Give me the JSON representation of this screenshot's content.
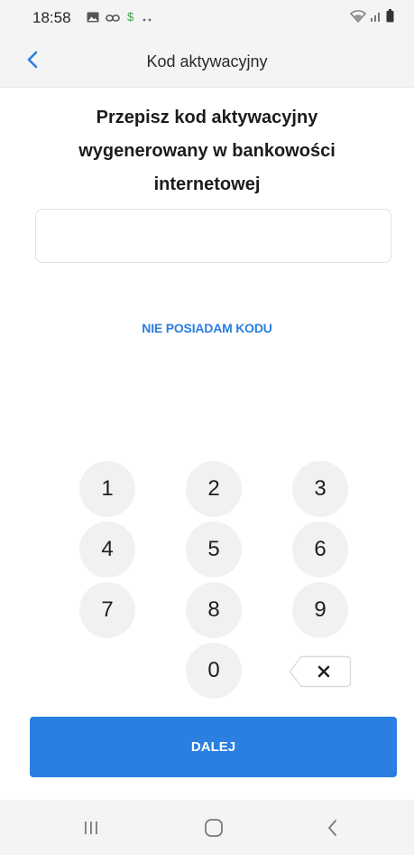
{
  "status_bar": {
    "time": "18:58",
    "left_icons": [
      "gallery-icon",
      "link-icon",
      "dollar-icon",
      "more-dots-icon"
    ],
    "right_icons": [
      "wifi-icon",
      "signal-icon",
      "battery-icon"
    ]
  },
  "header": {
    "title": "Kod aktywacyjny",
    "back_icon": "chevron-left-icon"
  },
  "instruction": "Przepisz kod aktywacyjny wygenerowany w bankowości internetowej",
  "code_input": {
    "value": "",
    "placeholder": ""
  },
  "no_code_link": "NIE POSIADAM KODU",
  "keypad": {
    "keys": [
      "1",
      "2",
      "3",
      "4",
      "5",
      "6",
      "7",
      "8",
      "9",
      "0"
    ],
    "backspace_icon": "backspace-icon"
  },
  "next_button": "DALEJ",
  "nav_bar": {
    "recent_icon": "recent-apps-icon",
    "home_icon": "home-icon",
    "back_icon": "back-icon"
  },
  "colors": {
    "accent": "#2a7fe0",
    "key_background": "#f1f1f1",
    "bar_background": "#f4f4f4"
  }
}
